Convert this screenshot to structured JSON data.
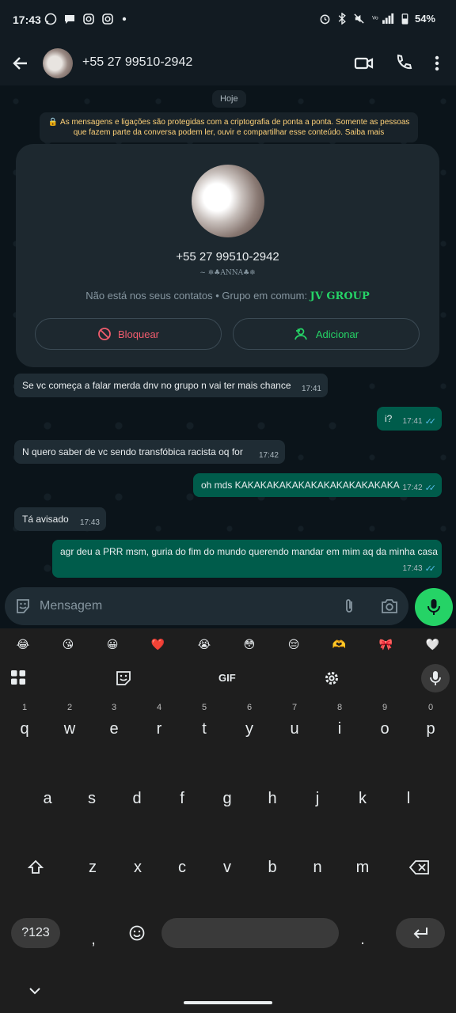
{
  "status_bar": {
    "time": "17:43",
    "battery": "54%"
  },
  "app_bar": {
    "contact": "+55 27 99510-2942"
  },
  "chat": {
    "date_chip": "Hoje",
    "encryption_notice": "As mensagens e ligações são protegidas com a criptografia de ponta a ponta. Somente as pessoas que fazem parte da conversa podem ler, ouvir e compartilhar esse conteúdo. Saiba mais",
    "profile": {
      "phone": "+55 27 99510-2942",
      "about": "~ ❄♣ANNA♣❄",
      "info_prefix": "Não está nos seus contatos • Grupo em comum: ",
      "group_name": "JV GROUP",
      "block_label": "Bloquear",
      "add_label": "Adicionar"
    },
    "messages": [
      {
        "dir": "in",
        "text": "Se vc começa a falar merda dnv no grupo n vai ter mais chance",
        "time": "17:41"
      },
      {
        "dir": "out",
        "text": "i?",
        "time": "17:41"
      },
      {
        "dir": "in",
        "text": "N quero saber de vc sendo transfóbica racista oq for",
        "time": "17:42"
      },
      {
        "dir": "out",
        "text": "oh mds KAKAKAKAKAKAKAKAKAKAKAKAKA",
        "time": "17:42"
      },
      {
        "dir": "in",
        "text": "Tá avisado",
        "time": "17:43"
      },
      {
        "dir": "out",
        "text": "agr deu a PRR msm, guria do fim do mundo querendo mandar em mim aq da minha casa",
        "time": "17:43"
      }
    ]
  },
  "input": {
    "placeholder": "Mensagem"
  },
  "keyboard": {
    "emoji_row": [
      "😂",
      "😘",
      "😀",
      "❤️",
      "😭",
      "😳",
      "😔",
      "🫶",
      "🎀",
      "🤍"
    ],
    "toolbar_gif": "GIF",
    "row1": [
      {
        "hint": "1",
        "key": "q"
      },
      {
        "hint": "2",
        "key": "w"
      },
      {
        "hint": "3",
        "key": "e"
      },
      {
        "hint": "4",
        "key": "r"
      },
      {
        "hint": "5",
        "key": "t"
      },
      {
        "hint": "6",
        "key": "y"
      },
      {
        "hint": "7",
        "key": "u"
      },
      {
        "hint": "8",
        "key": "i"
      },
      {
        "hint": "9",
        "key": "o"
      },
      {
        "hint": "0",
        "key": "p"
      }
    ],
    "row2": [
      "a",
      "s",
      "d",
      "f",
      "g",
      "h",
      "j",
      "k",
      "l"
    ],
    "row3": [
      "z",
      "x",
      "c",
      "v",
      "b",
      "n",
      "m"
    ],
    "symbols_key": "?123",
    "comma": ",",
    "period": "."
  },
  "colors": {
    "accent": "#25d366",
    "outgoing_bubble": "#005c4b",
    "incoming_bubble": "#1f2c34",
    "block_red": "#f15c6d"
  }
}
